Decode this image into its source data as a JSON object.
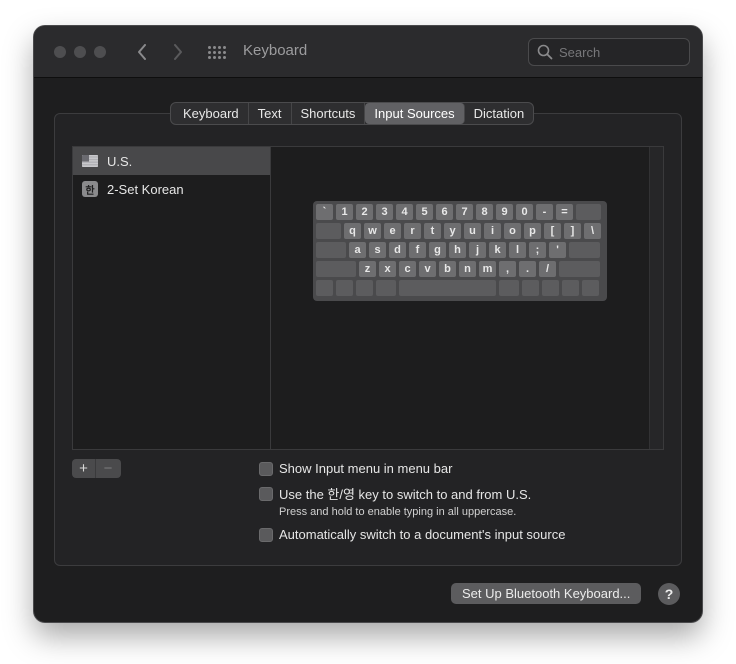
{
  "window": {
    "title": "Keyboard",
    "search_placeholder": "Search"
  },
  "tabs": [
    {
      "label": "Keyboard",
      "active": false
    },
    {
      "label": "Text",
      "active": false
    },
    {
      "label": "Shortcuts",
      "active": false
    },
    {
      "label": "Input Sources",
      "active": true
    },
    {
      "label": "Dictation",
      "active": false
    }
  ],
  "sources": [
    {
      "label": "U.S.",
      "icon": "us-flag-icon",
      "selected": true
    },
    {
      "label": "2-Set Korean",
      "icon_text": "한",
      "icon": "korean-input-icon",
      "selected": false
    }
  ],
  "keyboard": {
    "row1": [
      "`",
      "1",
      "2",
      "3",
      "4",
      "5",
      "6",
      "7",
      "8",
      "9",
      "0",
      "-",
      "="
    ],
    "row2": [
      "q",
      "w",
      "e",
      "r",
      "t",
      "y",
      "u",
      "i",
      "o",
      "p",
      "[",
      "]",
      "\\"
    ],
    "row3": [
      "a",
      "s",
      "d",
      "f",
      "g",
      "h",
      "j",
      "k",
      "l",
      ";",
      "'"
    ],
    "row4": [
      "z",
      "x",
      "c",
      "v",
      "b",
      "n",
      "m",
      ",",
      ".",
      "/"
    ]
  },
  "controls": {
    "add_label": "+",
    "remove_label": "−"
  },
  "options": {
    "show_menu": "Show Input menu in menu bar",
    "use_key": "Use the 한/영 key to switch to and from U.S.",
    "use_key_note": "Press and hold to enable typing in all uppercase.",
    "auto_switch": "Automatically switch to a document's input source"
  },
  "footer": {
    "bluetooth_button": "Set Up Bluetooth Keyboard...",
    "help_label": "?"
  },
  "colors": {
    "window_bg": "#1e1e1f",
    "selection": "#48484a",
    "active_tab": "#616164"
  }
}
